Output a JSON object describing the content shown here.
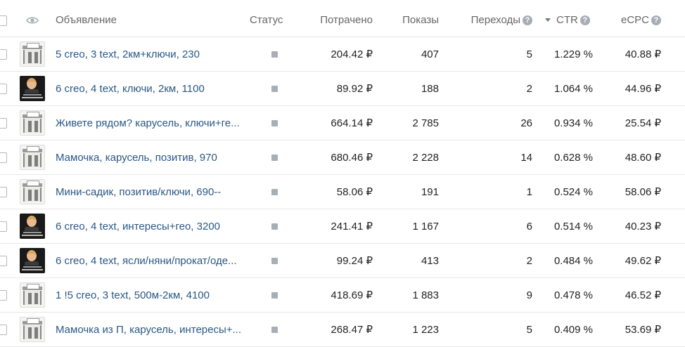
{
  "columns": {
    "ad": "Объявление",
    "status": "Статус",
    "spent": "Потрачено",
    "impressions": "Показы",
    "clicks": "Переходы",
    "ctr": "CTR",
    "ecpc": "eCPC",
    "help_glyph": "?"
  },
  "rows": [
    {
      "thumb": "house",
      "name": "5 creo, 3 text, 2км+ключи, 230",
      "spent": "204.42 ₽",
      "impressions": "407",
      "clicks": "5",
      "ctr": "1.229 %",
      "ecpc": "40.88 ₽"
    },
    {
      "thumb": "person",
      "name": "6 creo, 4 text, ключи, 2км, 1100",
      "spent": "89.92 ₽",
      "impressions": "188",
      "clicks": "2",
      "ctr": "1.064 %",
      "ecpc": "44.96 ₽"
    },
    {
      "thumb": "house",
      "name": "Живете рядом? карусель, ключи+ге...",
      "spent": "664.14 ₽",
      "impressions": "2 785",
      "clicks": "26",
      "ctr": "0.934 %",
      "ecpc": "25.54 ₽"
    },
    {
      "thumb": "house",
      "name": "Мамочка, карусель, позитив, 970",
      "spent": "680.46 ₽",
      "impressions": "2 228",
      "clicks": "14",
      "ctr": "0.628 %",
      "ecpc": "48.60 ₽"
    },
    {
      "thumb": "house",
      "name": "Мини-садик, позитив/ключи, 690--",
      "spent": "58.06 ₽",
      "impressions": "191",
      "clicks": "1",
      "ctr": "0.524 %",
      "ecpc": "58.06 ₽"
    },
    {
      "thumb": "person",
      "name": "6 creo, 4 text, интересы+гео, 3200",
      "spent": "241.41 ₽",
      "impressions": "1 167",
      "clicks": "6",
      "ctr": "0.514 %",
      "ecpc": "40.23 ₽"
    },
    {
      "thumb": "person",
      "name": "6 creo, 4 text, ясли/няни/прокат/оде...",
      "spent": "99.24 ₽",
      "impressions": "413",
      "clicks": "2",
      "ctr": "0.484 %",
      "ecpc": "49.62 ₽"
    },
    {
      "thumb": "house",
      "name": "1 !5 creo, 3 text, 500м-2км, 4100",
      "spent": "418.69 ₽",
      "impressions": "1 883",
      "clicks": "9",
      "ctr": "0.478 %",
      "ecpc": "46.52 ₽"
    },
    {
      "thumb": "house",
      "name": "Мамочка из П, карусель, интересы+...",
      "spent": "268.47 ₽",
      "impressions": "1 223",
      "clicks": "5",
      "ctr": "0.409 %",
      "ecpc": "53.69 ₽"
    }
  ]
}
